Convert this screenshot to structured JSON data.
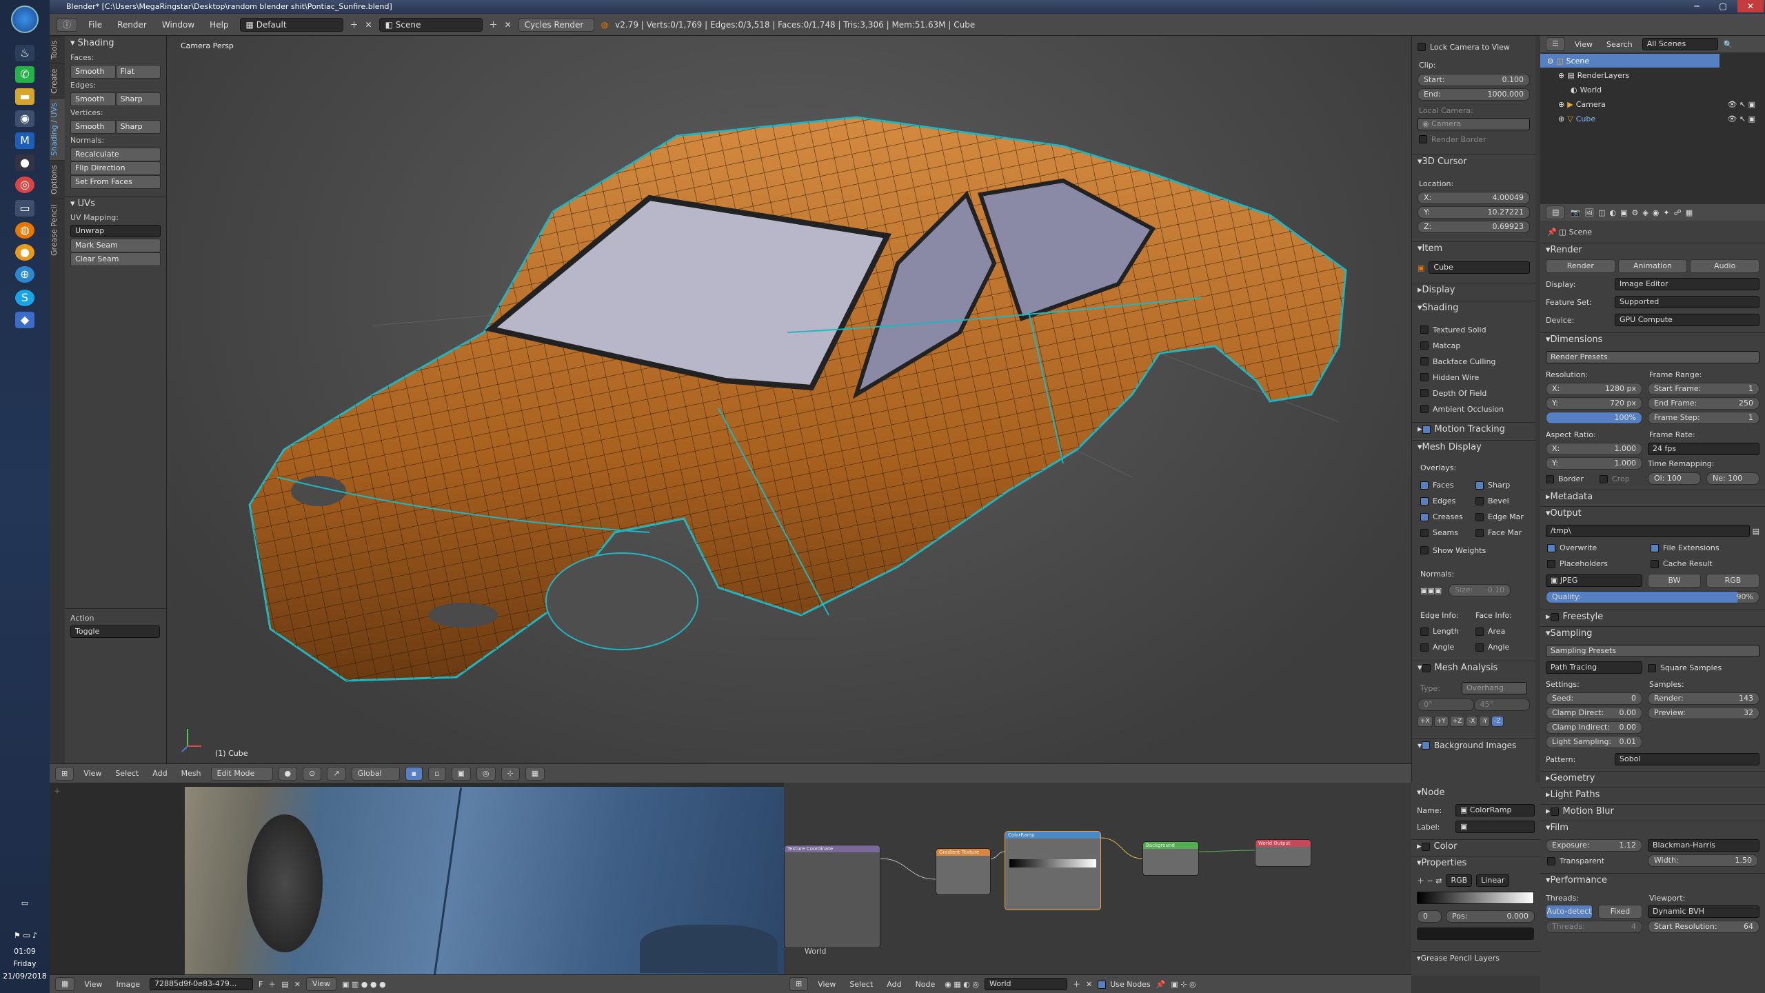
{
  "window": {
    "title": "Blender* [C:\\Users\\MegaRingstar\\Desktop\\random blender shit\\Pontiac_Sunfire.blend]"
  },
  "taskbar": {
    "time": "01:09",
    "day": "Friday",
    "date": "21/09/2018"
  },
  "info_header": {
    "menus": [
      "File",
      "Render",
      "Window",
      "Help"
    ],
    "layout": "Default",
    "scene": "Scene",
    "engine": "Cycles Render",
    "stats": "v2.79 | Verts:0/1,769 | Edges:0/3,518 | Faces:0/1,748 | Tris:3,306 | Mem:51.63M | Cube"
  },
  "toolshelf": {
    "tabs": [
      "Tools",
      "Create",
      "Shading / UVs",
      "Options",
      "Grease Pencil"
    ],
    "shading": {
      "title": "Shading",
      "faces_label": "Faces:",
      "smooth": "Smooth",
      "flat": "Flat",
      "edges_label": "Edges:",
      "sharp": "Sharp",
      "vertices_label": "Vertices:",
      "normals_label": "Normals:",
      "recalculate": "Recalculate",
      "flip": "Flip Direction",
      "set_from_faces": "Set From Faces"
    },
    "uvs": {
      "title": "UVs",
      "mapping_label": "UV Mapping:",
      "unwrap": "Unwrap",
      "mark_seam": "Mark Seam",
      "clear_seam": "Clear Seam"
    },
    "action": {
      "label": "Action",
      "value": "Toggle"
    }
  },
  "viewport": {
    "label": "Camera Persp",
    "object_label": "(1) Cube"
  },
  "view3d_header": {
    "menus": [
      "View",
      "Select",
      "Add",
      "Mesh"
    ],
    "mode": "Edit Mode",
    "orientation": "Global"
  },
  "npanel": {
    "lock_camera": "Lock Camera to View",
    "clip_label": "Clip:",
    "clip_start": {
      "label": "Start:",
      "value": "0.100"
    },
    "clip_end": {
      "label": "End:",
      "value": "1000.000"
    },
    "local_camera": "Local Camera:",
    "camera": "Camera",
    "render_border": "Render Border",
    "cursor_title": "3D Cursor",
    "location": "Location:",
    "cx": {
      "label": "X:",
      "value": "4.00049"
    },
    "cy": {
      "label": "Y:",
      "value": "10.27221"
    },
    "cz": {
      "label": "Z:",
      "value": "0.69923"
    },
    "item_title": "Item",
    "item_name": "Cube",
    "display_title": "Display",
    "shading_title": "Shading",
    "shading_opts": [
      "Textured Solid",
      "Matcap",
      "Backface Culling",
      "Hidden Wire",
      "Depth Of Field",
      "Ambient Occlusion"
    ],
    "motion_tracking": "Motion Tracking",
    "mesh_display": "Mesh Display",
    "overlays": "Overlays:",
    "ov_faces": "Faces",
    "ov_sharp": "Sharp",
    "ov_edges": "Edges",
    "ov_bevel": "Bevel",
    "ov_creases": "Creases",
    "ov_edgemar": "Edge Mar",
    "ov_seams": "Seams",
    "ov_facemar": "Face Mar",
    "show_weights": "Show Weights",
    "normals": "Normals:",
    "size": "Size:",
    "size_val": "0.10",
    "edge_info": "Edge Info:",
    "face_info": "Face Info:",
    "length": "Length",
    "area": "Area",
    "angle": "Angle",
    "angle2": "Angle",
    "mesh_analysis": "Mesh Analysis",
    "type_label": "Type:",
    "type_val": "Overhang",
    "deg0": "0°",
    "deg45": "45°",
    "axes": [
      "+X",
      "+Y",
      "+Z",
      "-X",
      "-Y",
      "-Z"
    ],
    "background_images": "Background Images"
  },
  "outliner": {
    "menus": [
      "View",
      "Search"
    ],
    "filter": "All Scenes",
    "items": [
      "Scene",
      "RenderLayers",
      "World",
      "Camera",
      "Cube"
    ]
  },
  "properties": {
    "breadcrumb": "Scene",
    "render_title": "Render",
    "render_btns": [
      "Render",
      "Animation",
      "Audio"
    ],
    "display": {
      "label": "Display:",
      "value": "Image Editor"
    },
    "feature_set": {
      "label": "Feature Set:",
      "value": "Supported"
    },
    "device": {
      "label": "Device:",
      "value": "GPU Compute"
    },
    "dimensions_title": "Dimensions",
    "render_presets": "Render Presets",
    "resolution": "Resolution:",
    "res_x": {
      "label": "X:",
      "value": "1280 px"
    },
    "res_y": {
      "label": "Y:",
      "value": "720 px"
    },
    "res_pct": "100%",
    "frame_range": "Frame Range:",
    "start_frame": {
      "label": "Start Frame:",
      "value": "1"
    },
    "end_frame": {
      "label": "End Frame:",
      "value": "250"
    },
    "frame_step": {
      "label": "Frame Step:",
      "value": "1"
    },
    "aspect": "Aspect Ratio:",
    "asp_x": {
      "label": "X:",
      "value": "1.000"
    },
    "asp_y": {
      "label": "Y:",
      "value": "1.000"
    },
    "frame_rate": "Frame Rate:",
    "fps": "24 fps",
    "time_remap": "Time Remapping:",
    "old": "Ol: 100",
    "new": "Ne: 100",
    "border": "Border",
    "crop": "Crop",
    "metadata": "Metadata",
    "output": "Output",
    "path": "/tmp\\",
    "overwrite": "Overwrite",
    "file_ext": "File Extensions",
    "placeholders": "Placeholders",
    "cache_result": "Cache Result",
    "format": "JPEG",
    "bw": "BW",
    "rgb": "RGB",
    "quality_label": "Quality:",
    "quality": "90%",
    "quality_value": 90,
    "freestyle": "Freestyle",
    "sampling": "Sampling",
    "sampling_presets": "Sampling Presets",
    "square_samples": "Square Samples",
    "integrator": "Path Tracing",
    "settings": "Settings:",
    "samples": "Samples:",
    "seed": {
      "label": "Seed:",
      "value": "0"
    },
    "render_s": {
      "label": "Render:",
      "value": "143"
    },
    "preview_s": {
      "label": "Preview:",
      "value": "32"
    },
    "clamp_direct": {
      "label": "Clamp Direct:",
      "value": "0.00"
    },
    "clamp_indirect": {
      "label": "Clamp Indirect:",
      "value": "0.00"
    },
    "light_sampling": {
      "label": "Light Sampling:",
      "value": "0.01"
    },
    "pattern": {
      "label": "Pattern:",
      "value": "Sobol"
    },
    "geometry": "Geometry",
    "light_paths": "Light Paths",
    "motion_blur": "Motion Blur",
    "film": "Film",
    "exposure": {
      "label": "Exposure:",
      "value": "1.12"
    },
    "filter": "Blackman-Harris",
    "transparent": "Transparent",
    "width": {
      "label": "Width:",
      "value": "1.50"
    },
    "performance": "Performance",
    "threads": "Threads:",
    "viewport_lbl": "Viewport:",
    "auto_detect": "Auto-detect",
    "fixed": "Fixed",
    "dynamic_bvh": "Dynamic BVH",
    "threads_val": {
      "label": "Threads:",
      "value": "4"
    },
    "start_res": {
      "label": "Start Resolution:",
      "value": "64"
    }
  },
  "image_editor": {
    "menus": [
      "View",
      "Image"
    ],
    "image_name": "72885d9f-0e83-479..."
  },
  "node_editor": {
    "menus": [
      "View",
      "Select",
      "Add",
      "Node"
    ],
    "world": "World",
    "use_nodes": "Use Nodes",
    "world_label": "World",
    "nodes": [
      "Texture Coordinate",
      "Gradient Texture",
      "ColorRamp",
      "Background",
      "World Output"
    ]
  },
  "node_side": {
    "title": "Node",
    "name": {
      "label": "Name:",
      "value": "ColorRamp"
    },
    "label": {
      "label": "Label:",
      "value": ""
    },
    "color": "Color",
    "properties": "Properties",
    "rgb": "RGB",
    "linear": "Linear",
    "idx": "0",
    "pos": {
      "label": "Pos:",
      "value": "0.000"
    },
    "grease": "Grease Pencil Layers"
  },
  "colors": {
    "accent": "#5680c2",
    "mesh": "#c07a33",
    "wire_seam": "#1fb6c2"
  }
}
